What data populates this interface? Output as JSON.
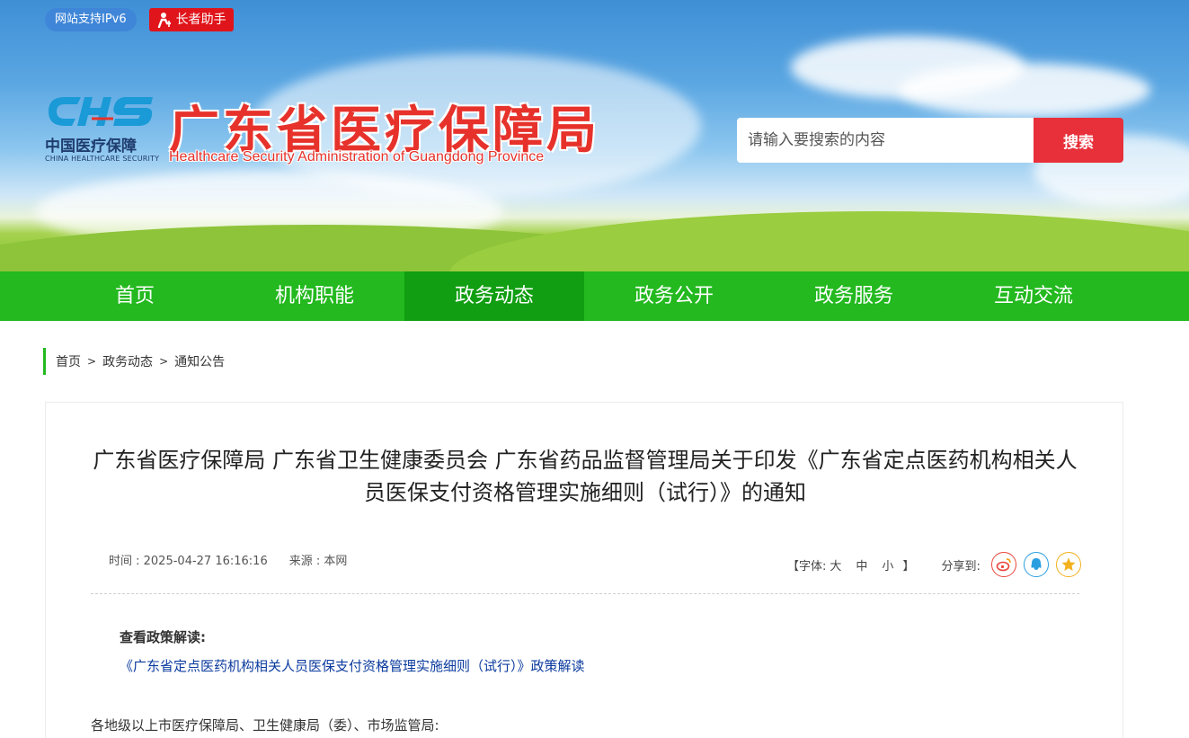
{
  "header": {
    "badges": {
      "ipv6": "网站支持IPv6",
      "elder": "长者助手"
    },
    "logo": {
      "mark": "CHS",
      "cn": "中国医疗保障",
      "en": "CHINA HEALTHCARE SECURITY"
    },
    "title": "广东省医疗保障局",
    "subtitle": "Healthcare Security Administration of Guangdong Province",
    "search": {
      "placeholder": "请输入要搜索的内容",
      "button": "搜索"
    }
  },
  "nav": {
    "items": [
      {
        "label": "首页",
        "active": false
      },
      {
        "label": "机构职能",
        "active": false
      },
      {
        "label": "政务动态",
        "active": true
      },
      {
        "label": "政务公开",
        "active": false
      },
      {
        "label": "政务服务",
        "active": false
      },
      {
        "label": "互动交流",
        "active": false
      }
    ]
  },
  "breadcrumb": {
    "items": [
      "首页",
      "政务动态",
      "通知公告"
    ],
    "separator": ">"
  },
  "article": {
    "title": "广东省医疗保障局 广东省卫生健康委员会 广东省药品监督管理局关于印发《广东省定点医药机构相关人员医保支付资格管理实施细则（试行）》的通知",
    "time": "时间 : 2025-04-27 16:16:16",
    "source": "来源 : 本网",
    "font_size": {
      "open": "【字体:",
      "large": "大",
      "medium": "中",
      "small": "小",
      "close": "】"
    },
    "share_label": "分享到:",
    "share_icons": [
      "weibo-icon",
      "qq-icon",
      "qzone-icon"
    ],
    "policy_heading": "查看政策解读:",
    "policy_link": "《广东省定点医药机构相关人员医保支付资格管理实施细则（试行）》政策解读",
    "body_first_line": "各地级以上市医疗保障局、卫生健康局（委）、市场监管局:"
  },
  "colors": {
    "nav_green": "#23b91f",
    "nav_active": "#119e12",
    "title_red": "#e6322b",
    "search_red": "#e8303a",
    "link_blue": "#0b3b9e"
  }
}
